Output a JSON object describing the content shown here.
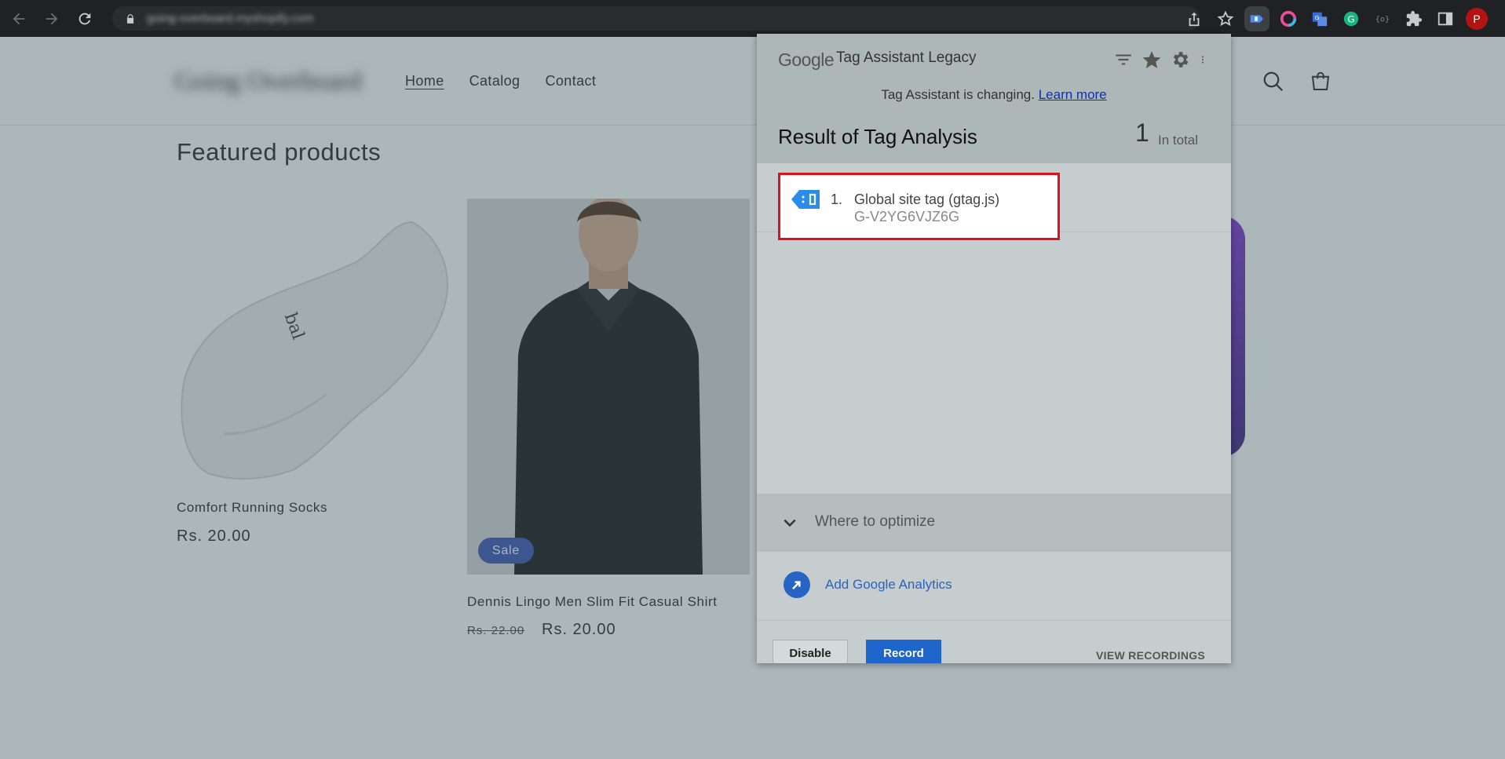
{
  "browser": {
    "url": "going-overboard.myshopify.com",
    "avatar_letter": "P",
    "icons": [
      "back-icon",
      "forward-icon",
      "reload-icon",
      "lock-icon",
      "share-icon",
      "bookmark-star-icon",
      "tag-assistant-extension-icon",
      "color-extension-icon",
      "translate-extension-icon",
      "grammarly-extension-icon",
      "extension-icon",
      "puzzle-icon",
      "sidepanel-icon"
    ]
  },
  "store": {
    "name": "Going Overboard",
    "nav": [
      "Home",
      "Catalog",
      "Contact"
    ],
    "section_title": "Featured products",
    "products": [
      {
        "title": "Comfort Running Socks",
        "price": "Rs. 20.00"
      },
      {
        "title": "Dennis Lingo Men Slim Fit Casual Shirt",
        "old_price": "Rs. 22.00",
        "price": "Rs. 20.00",
        "badge": "Sale"
      }
    ]
  },
  "popup": {
    "google": "Google",
    "title": "Tag Assistant Legacy",
    "notice": "Tag Assistant is changing.",
    "learn_more": "Learn more",
    "result_title": "Result of Tag Analysis",
    "total_count": "1",
    "total_label": "In total",
    "tags": [
      {
        "num": "1.",
        "name": "Global site tag (gtag.js)",
        "id": "G-V2YG6VJZ6G"
      }
    ],
    "optimize_label": "Where to optimize",
    "add_ga_label": "Add Google Analytics",
    "disable_label": "Disable",
    "record_label": "Record",
    "view_recordings_label": "VIEW RECORDINGS"
  },
  "colors": {
    "highlight_border": "#e0101c",
    "link": "#0b2fb8",
    "record_button": "#1f66cc",
    "sale_badge": "#334fb4"
  }
}
